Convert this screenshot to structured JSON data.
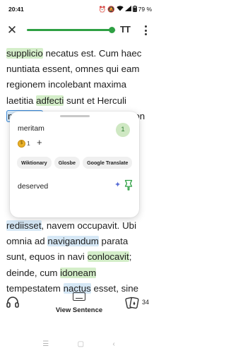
{
  "status_bar": {
    "time": "20:41",
    "icons": [
      "alarm-icon",
      "mute-icon",
      "wifi-icon",
      "signal-icon"
    ],
    "battery": "79 %"
  },
  "toolbar": {
    "close_icon": "close-icon",
    "progress": 0.95,
    "text_size_label": "TT",
    "more_icon": "more-vertical-icon"
  },
  "reading": {
    "lines": [
      [
        {
          "t": "supplicio",
          "h": "green"
        },
        {
          "t": " necatus est. Cum haec"
        }
      ],
      [
        {
          "t": "nuntiata essent, omnes qui eam"
        }
      ],
      [
        {
          "t": "regionem incolebant maxima"
        }
      ],
      [
        {
          "t": "laetitia "
        },
        {
          "t": "adfecti",
          "h": "green"
        },
        {
          "t": " sunt et Herculi"
        }
      ],
      [
        {
          "t": "meritam",
          "h": "selected"
        },
        {
          "t": " gratiam referebant. Non"
        }
      ],
      [
        {
          "t": ""
        }
      ],
      [
        {
          "t": ""
        }
      ],
      [
        {
          "t": ""
        }
      ],
      [
        {
          "t": ""
        }
      ],
      [
        {
          "t": ""
        }
      ],
      [
        {
          "t": ""
        }
      ],
      [
        {
          "t": "rediisset",
          "h": "blue"
        },
        {
          "t": ", navem occupavit. Ubi"
        }
      ],
      [
        {
          "t": "omnia ad "
        },
        {
          "t": "navigandum",
          "h": "blue"
        },
        {
          "t": " parata"
        }
      ],
      [
        {
          "t": "sunt, equos in navi "
        },
        {
          "t": "conlocavit",
          "h": "green"
        },
        {
          "t": ";"
        }
      ],
      [
        {
          "t": "deinde, cum "
        },
        {
          "t": "idoneam",
          "h": "green"
        }
      ],
      [
        {
          "t": "tempestatem "
        },
        {
          "t": "nactus",
          "h": "blue"
        },
        {
          "t": " esset, sine"
        }
      ]
    ]
  },
  "popup": {
    "word": "meritam",
    "level": "1",
    "coin_count": "1",
    "plus": "+",
    "links": [
      "Wiktionary",
      "Glosbe",
      "Google Translate"
    ],
    "meaning": "deserved"
  },
  "bottom_bar": {
    "view_sentence_label": "View Sentence",
    "cards_count": "34"
  },
  "colors": {
    "accent": "#2ea043",
    "known_highlight": "#d4eec9",
    "new_highlight": "#d6e8f6",
    "selected_border": "#3d8ad8"
  }
}
